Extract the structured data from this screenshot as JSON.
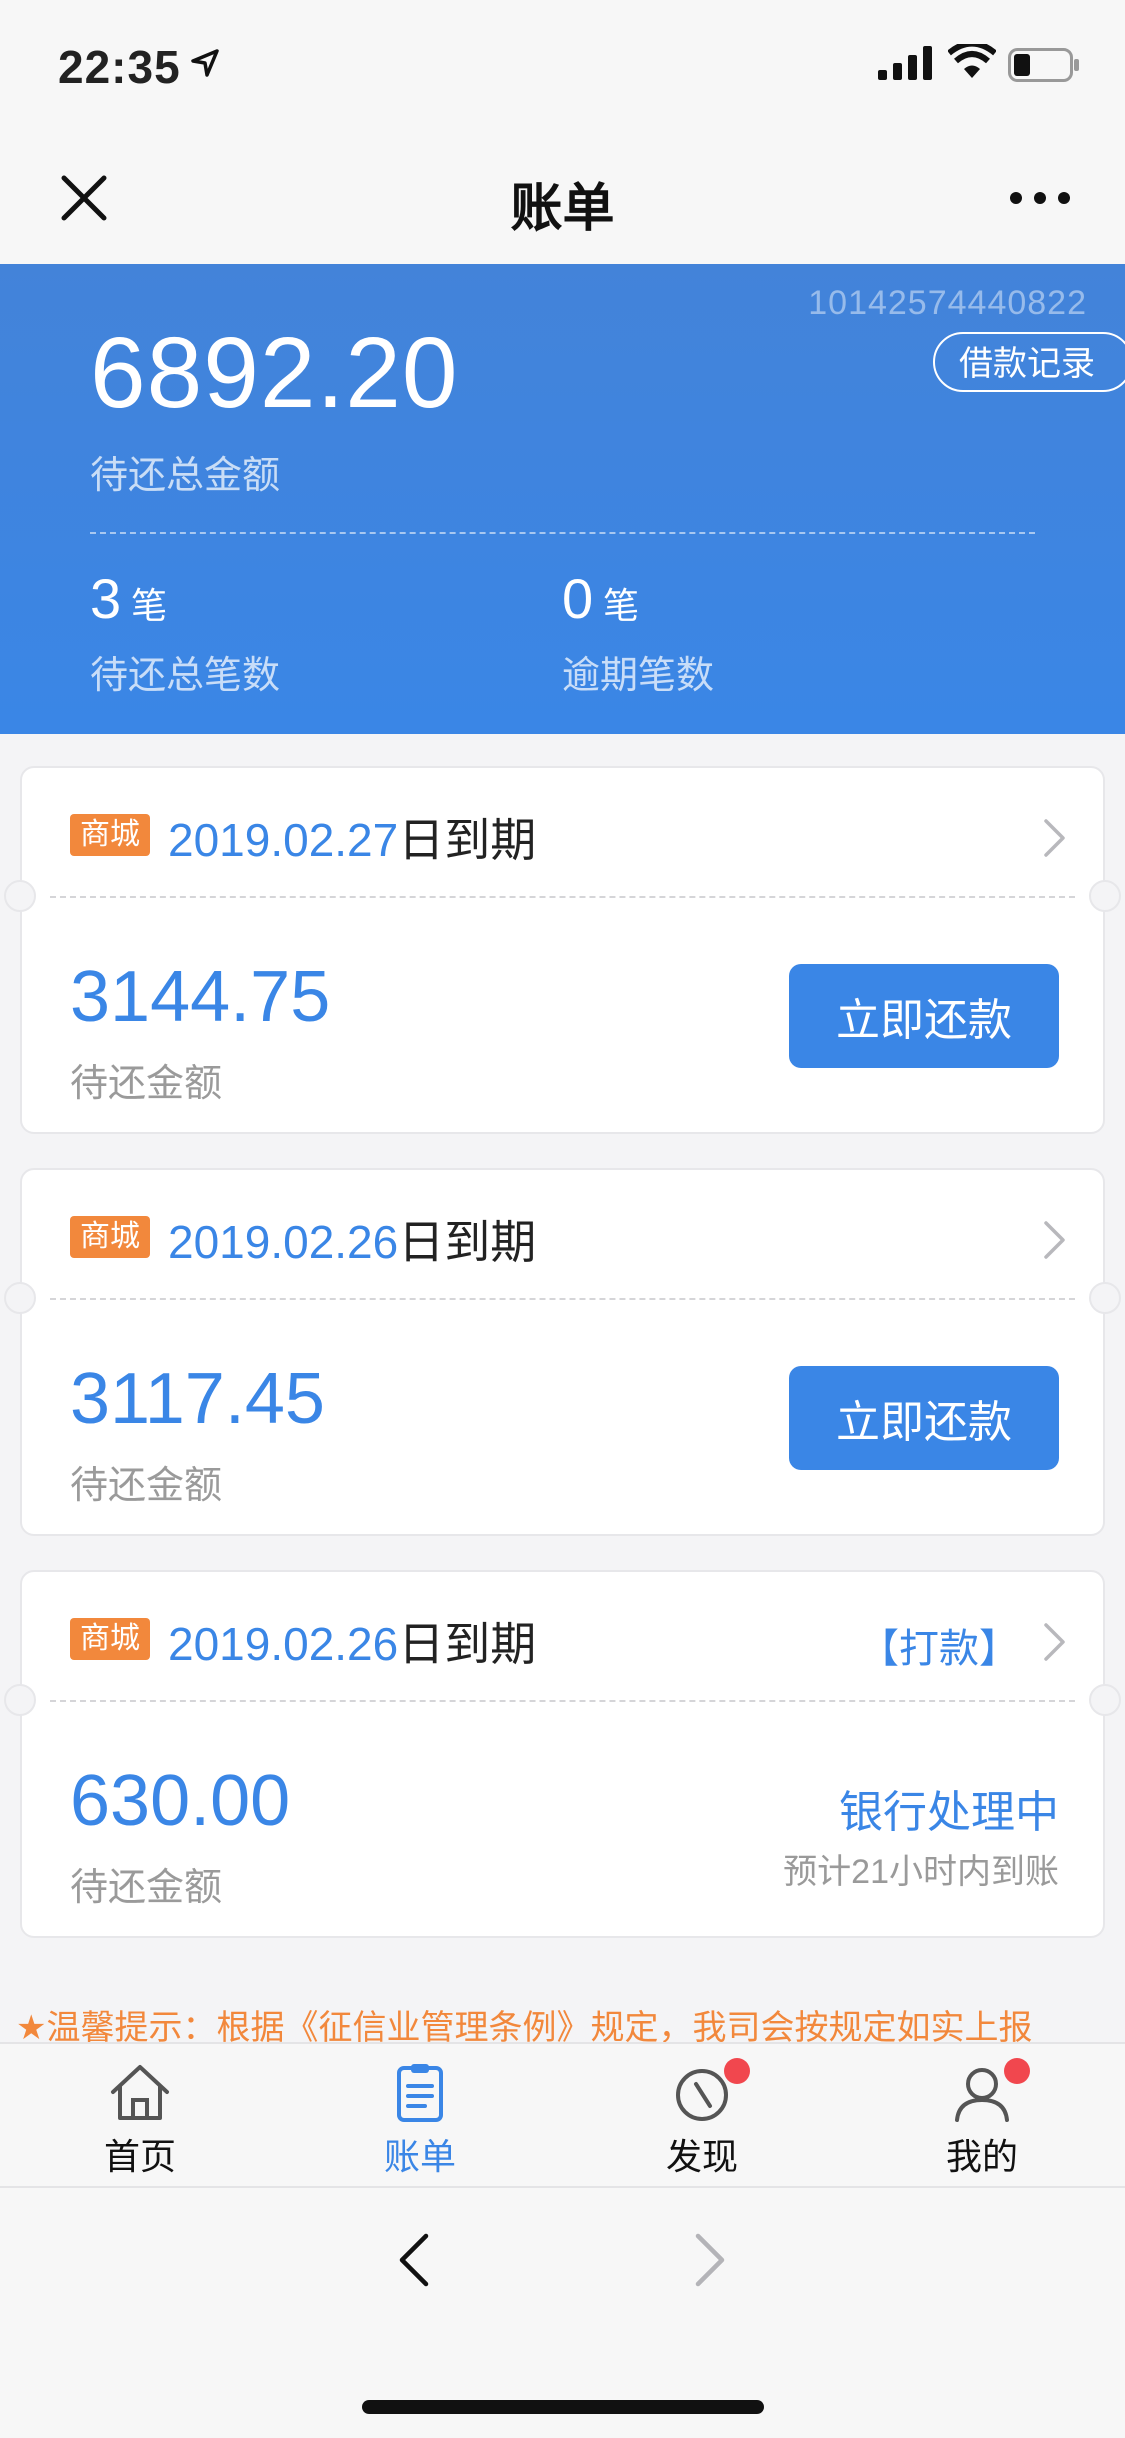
{
  "status_bar": {
    "time": "22:35"
  },
  "nav": {
    "title": "账单"
  },
  "summary": {
    "account_no": "10142574440822",
    "loan_record_label": "借款记录",
    "total_amount": "6892.20",
    "total_label": "待还总金额",
    "pending_count": "3",
    "pending_unit": "笔",
    "pending_label": "待还总笔数",
    "overdue_count": "0",
    "overdue_unit": "笔",
    "overdue_label": "逾期笔数"
  },
  "bills": [
    {
      "tag": "商城",
      "date": "2019.02.27",
      "due_suffix": "日到期",
      "amount": "3144.75",
      "amount_label": "待还金额",
      "action_label": "立即还款"
    },
    {
      "tag": "商城",
      "date": "2019.02.26",
      "due_suffix": "日到期",
      "amount": "3117.45",
      "amount_label": "待还金额",
      "action_label": "立即还款"
    },
    {
      "tag": "商城",
      "date": "2019.02.26",
      "due_suffix": "日到期",
      "amount": "630.00",
      "amount_label": "待还金额",
      "wire_label": "【打款】",
      "status": "银行处理中",
      "eta": "预计21小时内到账"
    }
  ],
  "tip": "★温馨提示：根据《征信业管理条例》规定，我司会按规定如实上报",
  "tabbar": {
    "items": [
      {
        "label": "首页",
        "icon": "home-icon"
      },
      {
        "label": "账单",
        "icon": "bill-icon",
        "active": true
      },
      {
        "label": "发现",
        "icon": "compass-icon",
        "badge": true
      },
      {
        "label": "我的",
        "icon": "user-icon",
        "badge": true
      }
    ]
  },
  "colors": {
    "primary": "#3a86e6",
    "tag": "#f2883c",
    "badge": "#f1474e"
  }
}
